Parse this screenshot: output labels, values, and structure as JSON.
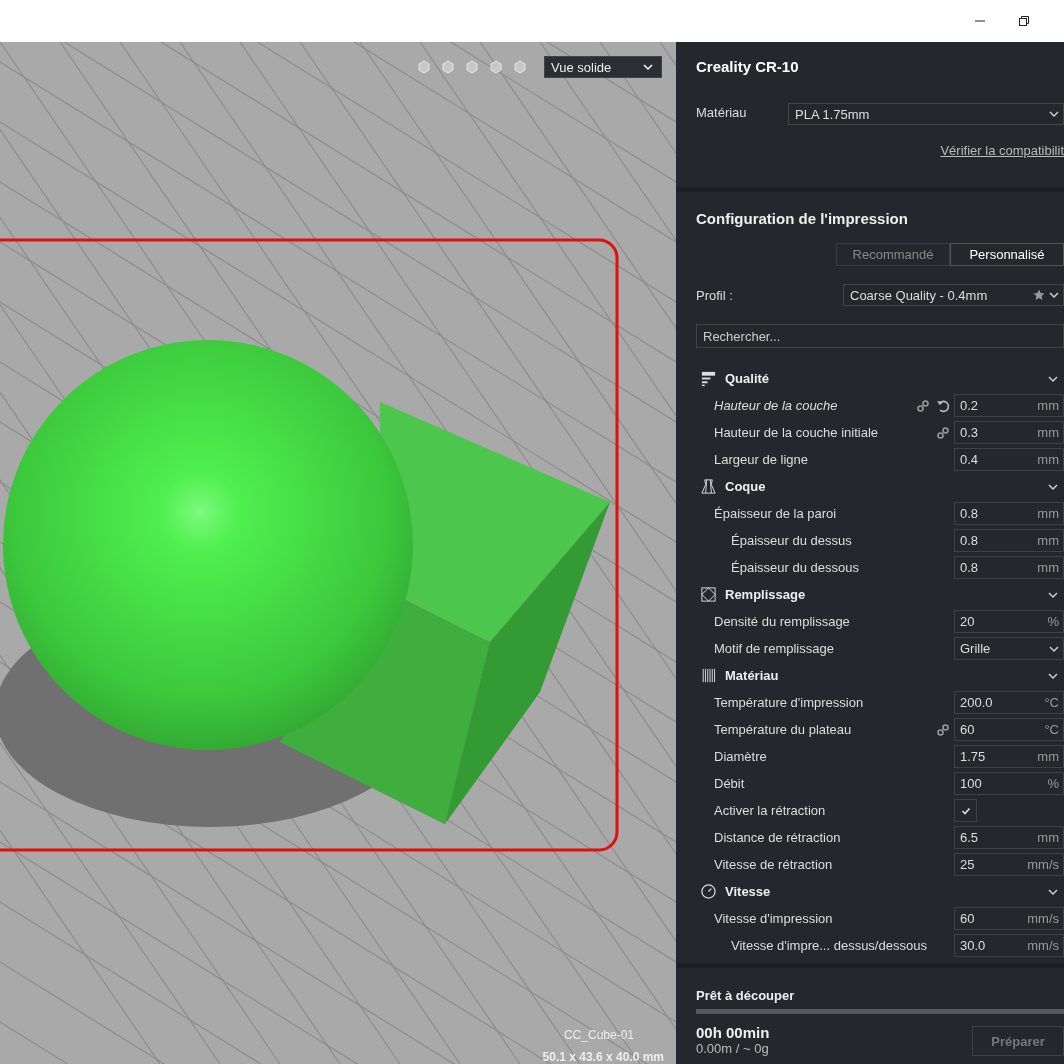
{
  "window": {
    "controls": [
      {
        "kind": "minimize"
      },
      {
        "kind": "restore"
      }
    ]
  },
  "viewport": {
    "view_select": "Vue solide",
    "object_name": "CC_Cube-01",
    "object_size": "50.1 x 43.6 x 40.0 mm"
  },
  "printer": {
    "name": "Creality CR-10",
    "material_label": "Matériau",
    "material": "PLA 1.75mm",
    "compat_link": "Vérifier la compatibilit"
  },
  "print_setup": {
    "title": "Configuration de l'impression",
    "tabs": [
      {
        "label": "Recommandé",
        "selected": false
      },
      {
        "label": "Personnalisé",
        "selected": true
      }
    ],
    "profile_label": "Profil :",
    "profile": "Coarse Quality - 0.4mm",
    "search": {
      "placeholder": "Rechercher..."
    },
    "sections": [
      {
        "title": "Qualité",
        "kind": "quality",
        "expanded": true,
        "settings": [
          {
            "label": "Hauteur de la couche",
            "kind": "field",
            "value": "0.2",
            "unit": "mm",
            "linked": true,
            "modified": true
          },
          {
            "label": "Hauteur de la couche initiale",
            "kind": "field",
            "value": "0.3",
            "unit": "mm",
            "linked": true,
            "modified": false
          },
          {
            "label": "Largeur de ligne",
            "kind": "field",
            "value": "0.4",
            "unit": "mm",
            "linked": false,
            "modified": false
          }
        ]
      },
      {
        "title": "Coque",
        "kind": "shell",
        "expanded": true,
        "settings": [
          {
            "label": "Épaisseur de la paroi",
            "kind": "field",
            "value": "0.8",
            "unit": "mm",
            "linked": false,
            "modified": false,
            "children": [
              {
                "label": "Épaisseur du dessus",
                "kind": "field",
                "value": "0.8",
                "unit": "mm",
                "linked": false,
                "modified": false
              },
              {
                "label": "Épaisseur du dessous",
                "kind": "field",
                "value": "0.8",
                "unit": "mm",
                "linked": false,
                "modified": false
              }
            ]
          }
        ]
      },
      {
        "title": "Remplissage",
        "kind": "infill",
        "expanded": true,
        "settings": [
          {
            "label": "Densité du remplissage",
            "kind": "field",
            "value": "20",
            "unit": "%",
            "linked": false,
            "modified": false
          },
          {
            "label": "Motif de remplissage",
            "kind": "select",
            "value": "Grille",
            "linked": false,
            "modified": false
          }
        ]
      },
      {
        "title": "Matériau",
        "kind": "material",
        "expanded": true,
        "settings": [
          {
            "label": "Température d'impression",
            "kind": "field",
            "value": "200.0",
            "unit": "°C",
            "linked": false,
            "modified": false
          },
          {
            "label": "Température du plateau",
            "kind": "field",
            "value": "60",
            "unit": "°C",
            "linked": true,
            "modified": false
          },
          {
            "label": "Diamètre",
            "kind": "field",
            "value": "1.75",
            "unit": "mm",
            "linked": false,
            "modified": false
          },
          {
            "label": "Débit",
            "kind": "field",
            "value": "100",
            "unit": "%",
            "linked": false,
            "modified": false
          },
          {
            "label": "Activer la rétraction",
            "kind": "checkbox",
            "checked": true,
            "linked": false,
            "modified": false
          },
          {
            "label": "Distance de rétraction",
            "kind": "field",
            "value": "6.5",
            "unit": "mm",
            "linked": false,
            "modified": false
          },
          {
            "label": "Vitesse de rétraction",
            "kind": "field",
            "value": "25",
            "unit": "mm/s",
            "linked": false,
            "modified": false
          }
        ]
      },
      {
        "title": "Vitesse",
        "kind": "speed",
        "expanded": true,
        "settings": [
          {
            "label": "Vitesse d'impression",
            "kind": "field",
            "value": "60",
            "unit": "mm/s",
            "linked": false,
            "modified": false,
            "children": [
              {
                "label": "Vitesse d'impre... dessus/dessous",
                "kind": "field",
                "value": "30.0",
                "unit": "mm/s",
                "linked": false,
                "modified": false
              }
            ]
          }
        ]
      }
    ]
  },
  "slice": {
    "title": "Prêt à découper",
    "level": 0,
    "time": "00h 00min",
    "usage": "0.00m / ~ 0g",
    "button": {
      "label": "Préparer",
      "disabled": true
    }
  }
}
